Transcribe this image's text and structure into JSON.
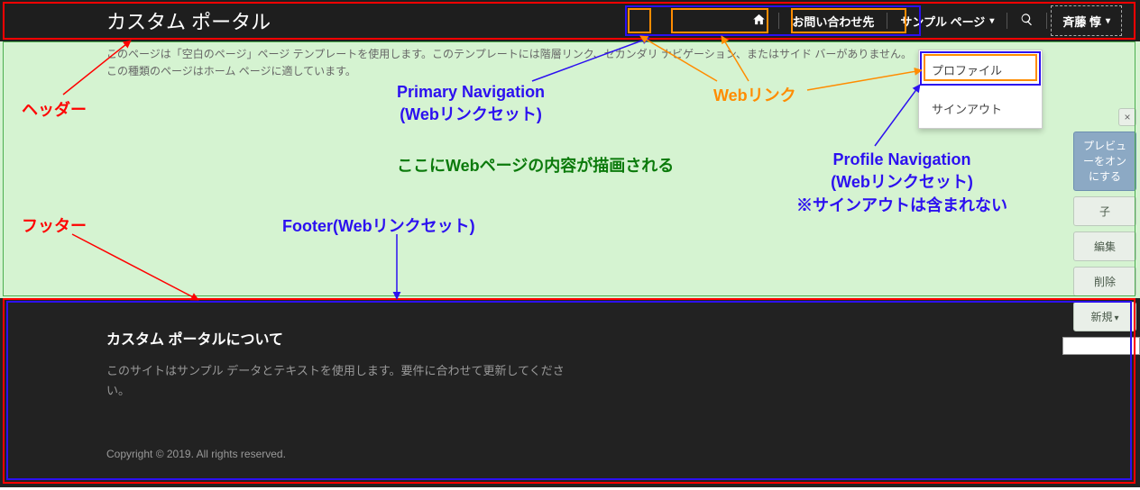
{
  "header": {
    "brand": "カスタム ポータル",
    "nav": {
      "home_icon": "home-icon",
      "contact": "お問い合わせ先",
      "sample_page": "サンプル ページ",
      "search_icon": "search-icon",
      "user": "斉藤 惇"
    }
  },
  "dropdown": {
    "profile": "プロファイル",
    "signout": "サインアウト"
  },
  "body": {
    "line1": "このページは「空白のページ」ページ テンプレートを使用します。このテンプレートには階層リンク、セカンダリ ナビゲーション、またはサイド バーがありません。",
    "line2": "この種類のページはホーム ページに適しています。"
  },
  "footer": {
    "title": "カスタム ポータルについて",
    "desc": "このサイトはサンプル データとテキストを使用します。要件に合わせて更新してください。",
    "copyright": "Copyright © 2019. All rights reserved."
  },
  "right_toolbar": {
    "close": "×",
    "preview": "プレビューをオンにする",
    "child": "子",
    "edit": "編集",
    "delete": "削除",
    "new": "新規"
  },
  "annotations": {
    "header_label": "ヘッダー",
    "footer_label": "フッター",
    "primary_nav_l1": "Primary Navigation",
    "primary_nav_l2": "(Webリンクセット)",
    "weblink_label": "Webリンク",
    "content_label": "ここにWebページの内容が描画される",
    "footer_set_label": "Footer(Webリンクセット)",
    "profile_nav_l1": "Profile Navigation",
    "profile_nav_l2": "(Webリンクセット)",
    "profile_nav_l3": "※サインアウトは含まれない"
  }
}
